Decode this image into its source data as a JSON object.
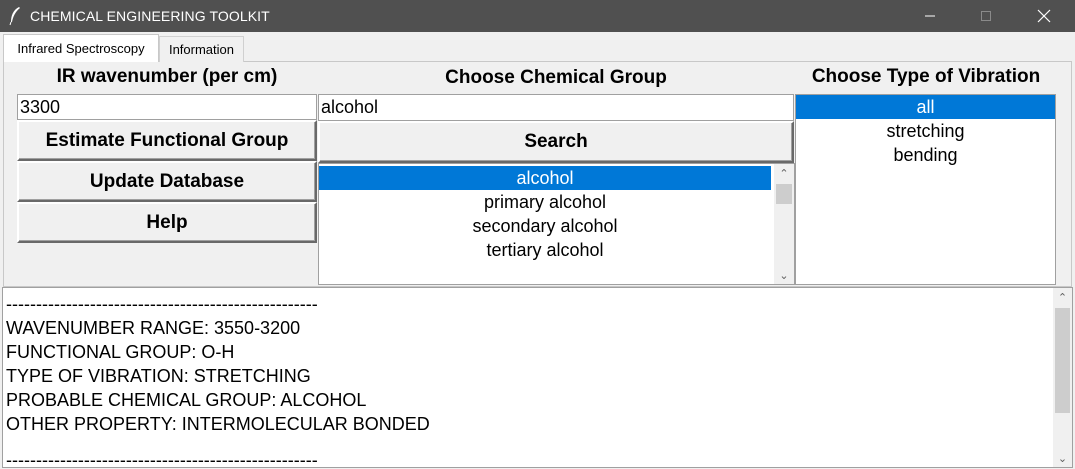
{
  "window": {
    "title": "CHEMICAL ENGINEERING TOOLKIT",
    "icon": "feather-icon",
    "controls": {
      "minimize": "—",
      "maximize": "☐",
      "close": "✕"
    }
  },
  "tabs": [
    {
      "label": "Infrared Spectroscopy",
      "active": true
    },
    {
      "label": "Information",
      "active": false
    }
  ],
  "ir_section": {
    "heading": "IR wavenumber (per cm)",
    "input_value": "3300",
    "buttons": {
      "estimate": "Estimate Functional Group",
      "update": "Update Database",
      "help": "Help"
    }
  },
  "group_section": {
    "heading": "Choose Chemical Group",
    "search_value": "alcohol",
    "search_button": "Search",
    "items": [
      "alcohol",
      "primary alcohol",
      "secondary alcohol",
      "tertiary alcohol"
    ],
    "selected_index": 0
  },
  "vibration_section": {
    "heading": "Choose Type of Vibration",
    "items": [
      "all",
      "stretching",
      "bending"
    ],
    "selected_index": 0
  },
  "output": {
    "lines": [
      "----------------------------------------------------",
      "WAVENUMBER RANGE: 3550-3200",
      "FUNCTIONAL GROUP: O-H",
      "TYPE OF VIBRATION: STRETCHING",
      "PROBABLE CHEMICAL GROUP: ALCOHOL",
      "OTHER PROPERTY: INTERMOLECULAR BONDED",
      "",
      "----------------------------------------------------"
    ]
  },
  "colors": {
    "titlebar": "#505050",
    "selection": "#0078d7",
    "window_bg": "#f0f0f0"
  }
}
